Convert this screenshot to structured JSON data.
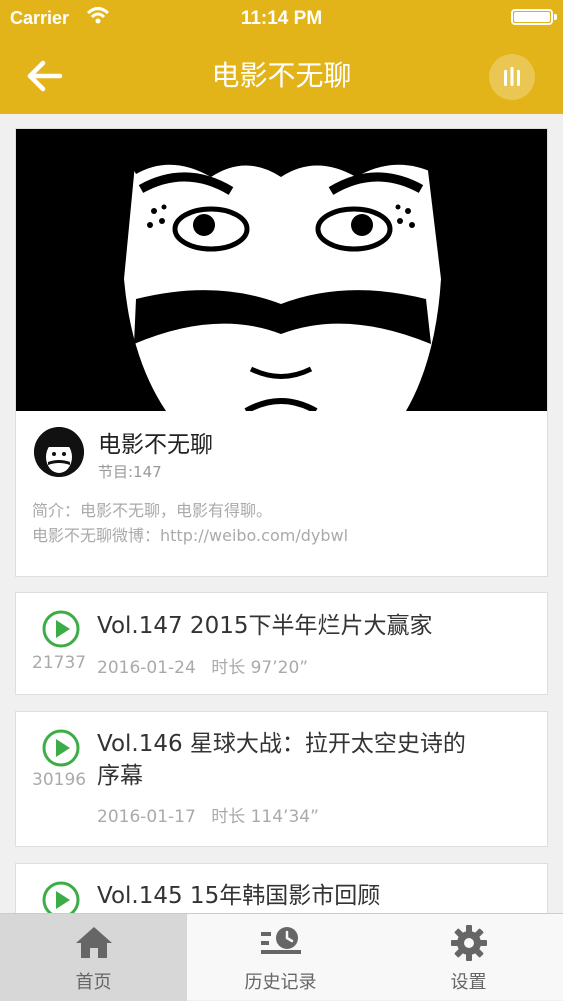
{
  "status_bar": {
    "carrier": "Carrier",
    "time": "11:14 PM"
  },
  "nav": {
    "title": "电影不无聊",
    "back_icon": "arrow-left-icon",
    "player_icon": "equalizer-icon"
  },
  "podcast": {
    "name": "电影不无聊",
    "episode_count": "节目:147",
    "intro": "简介：电影不无聊，电影有得聊。",
    "weibo": "电影不无聊微博：http://weibo.com/dybwl"
  },
  "episodes": [
    {
      "title": "Vol.147 2015下半年烂片大赢家",
      "plays": "21737",
      "date": "2016-01-24",
      "duration": "时长 97’20”"
    },
    {
      "title_line1": "Vol.146 星球大战：拉开太空史诗的",
      "title_line2": "序幕",
      "plays": "30196",
      "date": "2016-01-17",
      "duration": "时长 114’34”"
    },
    {
      "title": "Vol.145 15年韩国影市回顾"
    }
  ],
  "tabs": [
    {
      "label": "首页",
      "icon": "home-icon",
      "active": true
    },
    {
      "label": "历史记录",
      "icon": "history-icon",
      "active": false
    },
    {
      "label": "设置",
      "icon": "gear-icon",
      "active": false
    }
  ],
  "colors": {
    "accent": "#e3b419",
    "play_green": "#3cad46"
  }
}
